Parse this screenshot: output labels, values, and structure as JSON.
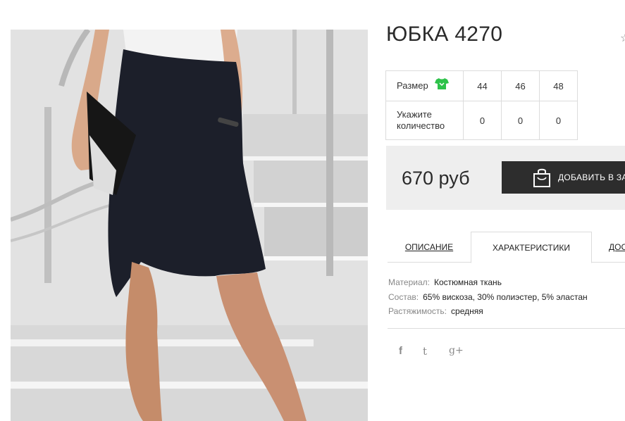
{
  "product": {
    "title": "ЮБКА 4270",
    "price": "670 руб",
    "add_to_cart_label": "ДОБАВИТЬ В ЗА"
  },
  "sizes": {
    "size_label": "Размер",
    "quantity_label": "Укажите количество",
    "columns": [
      {
        "size": "44",
        "qty": "0"
      },
      {
        "size": "46",
        "qty": "0"
      },
      {
        "size": "48",
        "qty": "0"
      }
    ]
  },
  "tabs": [
    {
      "label": "ОПИСАНИЕ",
      "active": false
    },
    {
      "label": "ХАРАКТЕРИСТИКИ",
      "active": true
    },
    {
      "label": "ДОС",
      "active": false
    }
  ],
  "specs": [
    {
      "key": "Материал:",
      "value": "Костюмная ткань"
    },
    {
      "key": "Состав:",
      "value": "65% вискоза, 30% полиэстер, 5% эластан"
    },
    {
      "key": "Растяжимость:",
      "value": "средняя"
    }
  ],
  "social": {
    "facebook": "f",
    "twitter": "t",
    "googleplus": "g+"
  },
  "icons": {
    "size_chart": "shirt-icon",
    "cart": "shopping-bag-icon",
    "favorite": "star-icon"
  },
  "colors": {
    "accent_green": "#2ec24a",
    "button_dark": "#2d2d2d",
    "buybox_bg": "#eeeeee"
  }
}
